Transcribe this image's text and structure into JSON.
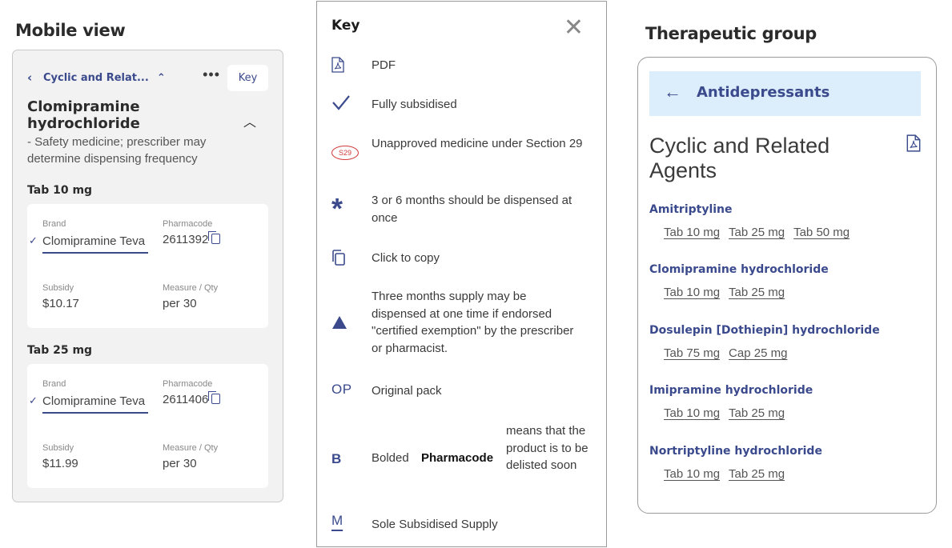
{
  "headings": {
    "mobile": "Mobile view",
    "therapeutic": "Therapeutic group"
  },
  "mobile": {
    "breadcrumb": "Cyclic and Relat...",
    "more": "•••",
    "key_button": "Key",
    "title": "Clomipramine hydrochloride",
    "note": "- Safety medicine; prescriber may determine dispensing frequency",
    "forms": [
      {
        "label": "Tab 10 mg",
        "brand_label": "Brand",
        "brand": "Clomipramine Teva",
        "pharmacode_label": "Pharmacode",
        "pharmacode": "2611392",
        "subsidy_label": "Subsidy",
        "subsidy": "$10.17",
        "measure_label": "Measure / Qty",
        "measure": "per 30"
      },
      {
        "label": "Tab 25 mg",
        "brand_label": "Brand",
        "brand": "Clomipramine Teva",
        "pharmacode_label": "Pharmacode",
        "pharmacode": "2611406",
        "subsidy_label": "Subsidy",
        "subsidy": "$11.99",
        "measure_label": "Measure / Qty",
        "measure": "per 30"
      }
    ]
  },
  "key": {
    "title": "Key",
    "items": [
      {
        "icon": "pdf-icon",
        "text": "PDF"
      },
      {
        "icon": "checkmark-icon",
        "text": "Fully subsidised"
      },
      {
        "icon": "s29-badge-icon",
        "symbol": "S29",
        "text": "Unapproved medicine under Section 29"
      },
      {
        "icon": "asterisk-icon",
        "symbol": "*",
        "text": "3 or 6 months should be dispensed at once"
      },
      {
        "icon": "copy-icon",
        "text": "Click to copy"
      },
      {
        "icon": "triangle-icon",
        "text": "Three months supply may be dispensed at one time if endorsed \"certified exemption\" by the prescriber or pharmacist."
      },
      {
        "icon": "original-pack-icon",
        "symbol": "OP",
        "text": "Original pack"
      },
      {
        "icon": "bold-b-icon",
        "symbol": "B",
        "text_before": "Bolded",
        "text_bold": "Pharmacode",
        "text_after": "means that the product is to be delisted soon"
      },
      {
        "icon": "sole-supply-icon",
        "symbol": "M",
        "text": "Sole Subsidised Supply"
      }
    ]
  },
  "therapeutic": {
    "back_label": "Antidepressants",
    "title": "Cyclic and Related Agents",
    "medicines": [
      {
        "name": "Amitriptyline",
        "forms": [
          "Tab 10 mg",
          "Tab 25 mg",
          "Tab 50 mg"
        ]
      },
      {
        "name": "Clomipramine hydrochloride",
        "forms": [
          "Tab 10 mg",
          "Tab 25 mg"
        ]
      },
      {
        "name": "Dosulepin [Dothiepin] hydrochloride",
        "forms": [
          "Tab 75 mg",
          "Cap 25 mg"
        ]
      },
      {
        "name": "Imipramine hydrochloride",
        "forms": [
          "Tab 10 mg",
          "Tab 25 mg"
        ]
      },
      {
        "name": "Nortriptyline hydrochloride",
        "forms": [
          "Tab 10 mg",
          "Tab 25 mg"
        ]
      }
    ]
  },
  "colors": {
    "accent": "#3a4a8c",
    "back_bar": "#dceefb",
    "s29_red": "#d23a3a"
  }
}
